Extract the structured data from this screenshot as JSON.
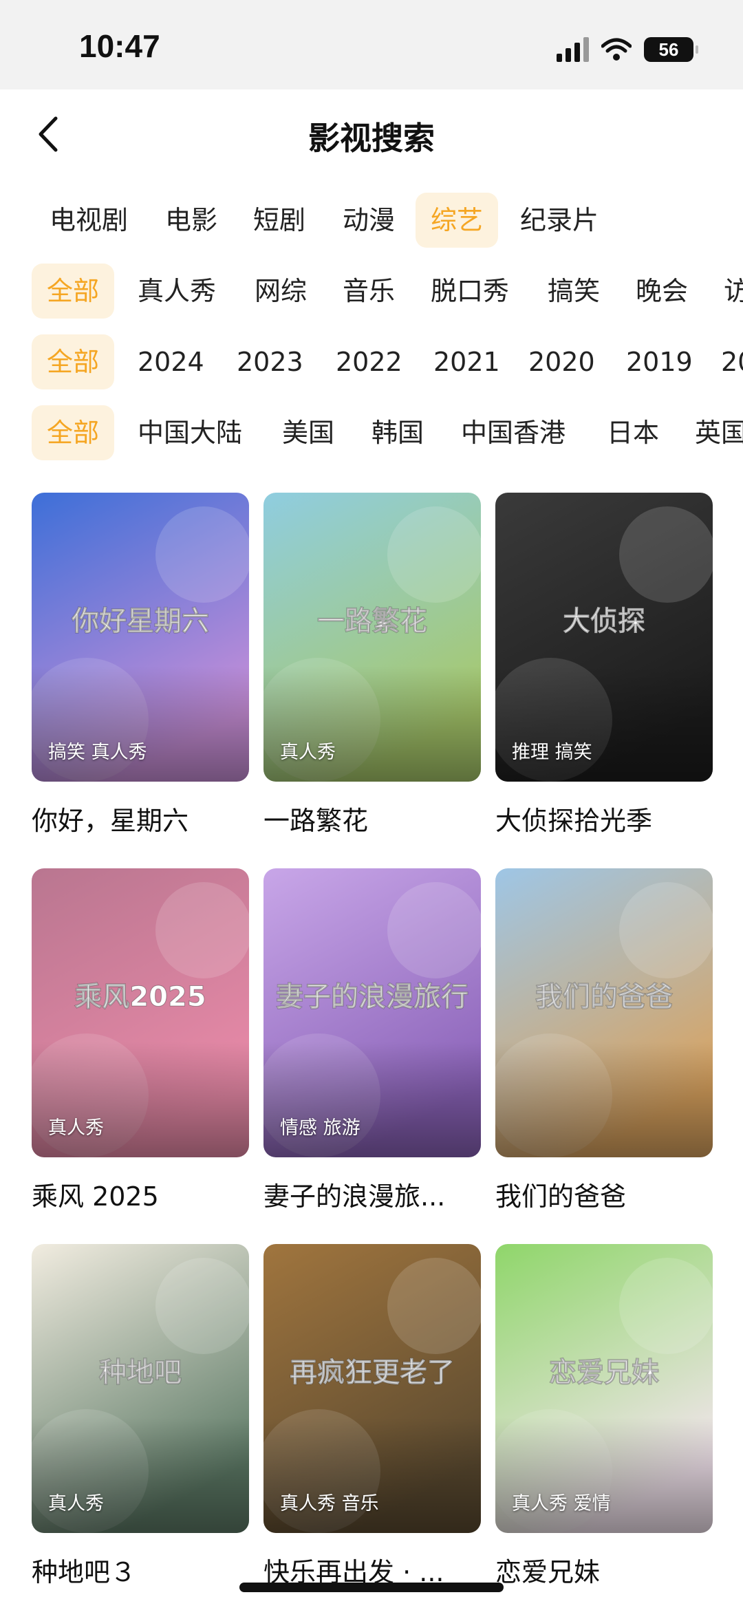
{
  "status": {
    "time": "10:47",
    "battery": "56"
  },
  "header": {
    "title": "影视搜索"
  },
  "type_tabs": [
    "电视剧",
    "电影",
    "短剧",
    "动漫",
    "综艺",
    "纪录片"
  ],
  "genre_filters": [
    "全部",
    "真人秀",
    "网综",
    "音乐",
    "脱口秀",
    "搞笑",
    "晚会",
    "访"
  ],
  "year_filters": [
    "全部",
    "2024",
    "2023",
    "2022",
    "2021",
    "2020",
    "2019",
    "20"
  ],
  "region_filters": [
    "全部",
    "中国大陆",
    "美国",
    "韩国",
    "中国香港",
    "日本",
    "英国"
  ],
  "cards": [
    {
      "title": "你好，星期六",
      "tags": "搞笑 真人秀",
      "poster_text": "你好星期六",
      "colors": [
        "#3d6fd8",
        "#c98fd8"
      ]
    },
    {
      "title": "一路繁花",
      "tags": "真人秀",
      "poster_text": "一路繁花",
      "colors": [
        "#8fcde0",
        "#a7c86a"
      ]
    },
    {
      "title": "大侦探拾光季",
      "tags": "推理 搞笑",
      "poster_text": "大侦探",
      "colors": [
        "#3a3a3a",
        "#1c1c1c"
      ]
    },
    {
      "title": "乘风 2025",
      "tags": "真人秀",
      "poster_text": "乘风2025",
      "colors": [
        "#b97690",
        "#e98aa8"
      ]
    },
    {
      "title": "妻子的浪漫旅...",
      "tags": "情感 旅游",
      "poster_text": "妻子的浪漫旅行",
      "colors": [
        "#c8a6e8",
        "#8a62b8"
      ]
    },
    {
      "title": "我们的爸爸",
      "tags": "",
      "poster_text": "我们的爸爸",
      "colors": [
        "#9ec6e6",
        "#d9a25e"
      ]
    },
    {
      "title": "种地吧３",
      "tags": "真人秀",
      "poster_text": "种地吧",
      "colors": [
        "#f1ece0",
        "#5d7a66"
      ]
    },
    {
      "title": "快乐再出发 · ...",
      "tags": "真人秀 音乐",
      "poster_text": "再疯狂更老了",
      "colors": [
        "#a0753e",
        "#5b4a30"
      ]
    },
    {
      "title": "恋爱兄妹",
      "tags": "真人秀 爱情",
      "poster_text": "恋爱兄妹",
      "colors": [
        "#8fd66a",
        "#f4e5ef"
      ]
    }
  ]
}
